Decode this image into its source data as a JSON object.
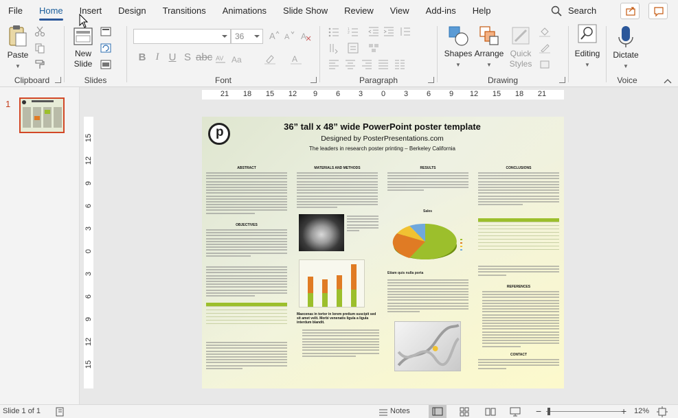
{
  "menu": {
    "items": [
      "File",
      "Home",
      "Insert",
      "Design",
      "Transitions",
      "Animations",
      "Slide Show",
      "Review",
      "View",
      "Add-ins",
      "Help"
    ],
    "active": "Home",
    "search_label": "Search"
  },
  "ribbon": {
    "clipboard": {
      "label": "Clipboard",
      "paste": "Paste"
    },
    "slides": {
      "label": "Slides",
      "new_slide_line1": "New",
      "new_slide_line2": "Slide"
    },
    "font": {
      "label": "Font",
      "font_name": "",
      "font_size": "36"
    },
    "paragraph": {
      "label": "Paragraph"
    },
    "drawing": {
      "label": "Drawing",
      "shapes": "Shapes",
      "arrange": "Arrange",
      "quick_styles_line1": "Quick",
      "quick_styles_line2": "Styles"
    },
    "editing": {
      "label": "Editing"
    },
    "voice": {
      "label": "Voice",
      "dictate": "Dictate"
    }
  },
  "thumbnails": {
    "slide_number": "1"
  },
  "ruler": {
    "horizontal": [
      "21",
      "18",
      "15",
      "12",
      "9",
      "6",
      "3",
      "0",
      "3",
      "6",
      "9",
      "12",
      "15",
      "18",
      "21"
    ],
    "vertical": [
      "15",
      "12",
      "9",
      "6",
      "3",
      "0",
      "3",
      "6",
      "9",
      "12",
      "15"
    ]
  },
  "poster": {
    "title": "36” tall x 48” wide PowerPoint poster template",
    "subtitle": "Designed by PosterPresentations.com",
    "tagline": "The leaders in research poster printing – Berkeley California",
    "sections": {
      "abstract": "ABSTRACT",
      "objectives": "OBJECTIVES",
      "materials": "MATERIALS AND METHODS",
      "results": "RESULTS",
      "conclusions": "CONCLUSIONS",
      "references": "REFERENCES",
      "contact": "CONTACT"
    },
    "sales_label": "Sales",
    "etiam_heading": "Etiam quis nulla porta",
    "maecenas_heading": "Maecenas in tortor in lorem pretium suscipit sed sit amet velit. Morbi venenatis ligula a ligula interdum blandit."
  },
  "status": {
    "slide_info": "Slide 1 of 1",
    "notes": "Notes",
    "zoom": "12%"
  }
}
